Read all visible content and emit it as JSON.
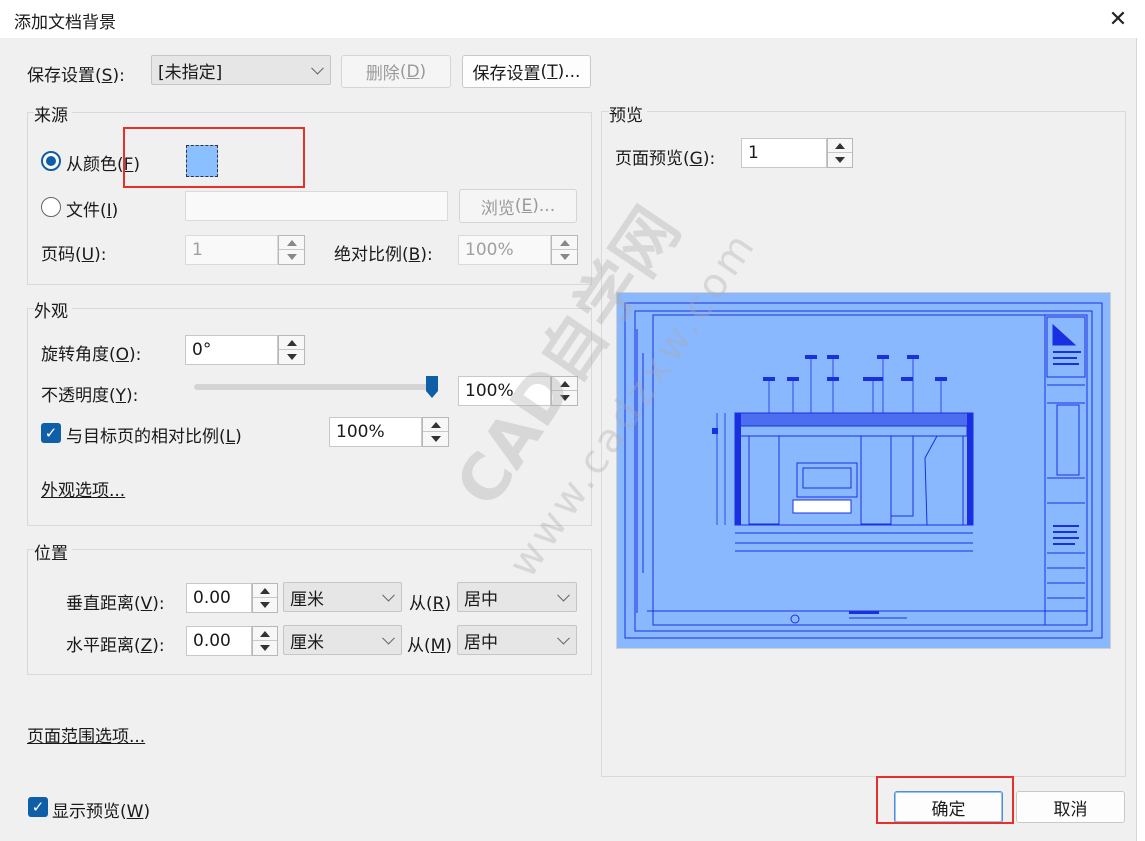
{
  "window": {
    "title": "添加文档背景",
    "close_glyph": "✕"
  },
  "top": {
    "saved_settings_label": "保存设置",
    "saved_settings_key": "S",
    "saved_settings_value": "[未指定]",
    "delete_label": "删除",
    "delete_key": "D",
    "save_settings_label": "保存设置",
    "save_settings_key": "T",
    "save_settings_suffix": "..."
  },
  "source": {
    "title": "来源",
    "from_color_label": "从颜色",
    "from_color_key": "F",
    "color_value": "#8ac0ff",
    "file_label": "文件",
    "file_key": "I",
    "file_path": "",
    "browse_label": "浏览",
    "browse_key": "E",
    "page_label": "页码",
    "page_key": "U",
    "page_value": "1",
    "abs_scale_label": "绝对比例",
    "abs_scale_key": "B",
    "abs_scale_value": "100%"
  },
  "appearance": {
    "title": "外观",
    "rotation_label": "旋转角度",
    "rotation_key": "O",
    "rotation_value": "0°",
    "opacity_label": "不透明度",
    "opacity_key": "Y",
    "opacity_value": "100%",
    "opacity_level": 1.0,
    "relative_scale_label": "与目标页的相对比例",
    "relative_scale_key": "L",
    "relative_scale_value": "100%",
    "relative_scale_checked": true,
    "options_link": "外观选项..."
  },
  "position": {
    "title": "位置",
    "vertical_label": "垂直距离",
    "vertical_key": "V",
    "vertical_value": "0.00",
    "vertical_unit": "厘米",
    "vertical_from_label": "从",
    "vertical_from_key": "R",
    "vertical_from_value": "居中",
    "horizontal_label": "水平距离",
    "horizontal_key": "Z",
    "horizontal_value": "0.00",
    "horizontal_unit": "厘米",
    "horizontal_from_label": "从",
    "horizontal_from_key": "M",
    "horizontal_from_value": "居中"
  },
  "page_range_link": "页面范围选项...",
  "show_preview": {
    "label": "显示预览",
    "key": "W",
    "checked": true
  },
  "preview": {
    "title": "预览",
    "page_label": "页面预览",
    "page_key": "G",
    "page_value": "1",
    "background_color": "#8ab8ff",
    "line_color": "#1a2fe0"
  },
  "footer": {
    "ok_label": "确定",
    "cancel_label": "取消"
  },
  "watermark": {
    "text": "CAD自学网",
    "url": "www.cadzxw.com"
  },
  "colors": {
    "accent": "#0e5fa8",
    "highlight": "#e8302a"
  }
}
